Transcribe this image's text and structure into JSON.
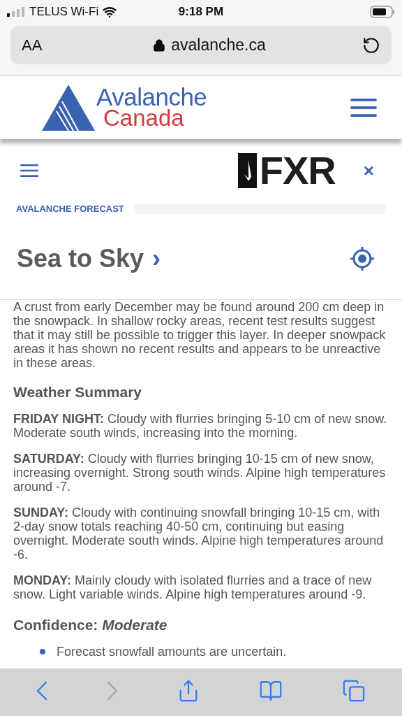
{
  "status_bar": {
    "carrier": "TELUS Wi-Fi",
    "time": "9:18 PM"
  },
  "browser": {
    "text_size_button": "AA",
    "url": "avalanche.ca"
  },
  "site_header": {
    "logo_line_1": "Avalanche",
    "logo_line_2": "Canada"
  },
  "sponsor_bar": {
    "logo": "FXR",
    "close": "×"
  },
  "section_label": "AVALANCHE FORECAST",
  "region_title": "Sea to Sky",
  "region_chevron": "›",
  "intro": "A crust from early December may be found around 200 cm deep in the snowpack. In shallow rocky areas, recent test results suggest that it may still be possible to trigger this layer. In deeper snowpack areas it has shown no recent results and appears to be unreactive in these areas.",
  "weather_heading": "Weather Summary",
  "weather": [
    {
      "text": "**FRIDAY NIGHT:** Cloudy with flurries bringing 5-10 cm of new snow. Moderate south winds, increasing into the morning."
    },
    {
      "text": "**SATURDAY:** Cloudy with flurries bringing 10-15 cm of new snow, increasing overnight. Strong south winds. Alpine high temperatures around -7."
    },
    {
      "text": "**SUNDAY:** Cloudy with continuing snowfall bringing 10-15 cm, with 2-day snow totals reaching 40-50 cm, continuing but easing overnight. Moderate south winds. Alpine high temperatures around -6."
    },
    {
      "text": "**MONDAY:** Mainly cloudy with isolated flurries and a trace of new snow. Light variable winds. Alpine high temperatures around -9."
    }
  ],
  "confidence_heading": "Confidence: *Moderate*",
  "confidence_bullets": [
    "Forecast snowfall amounts are uncertain."
  ],
  "toolbar": [
    {
      "kind": "back",
      "disabled": false
    },
    {
      "kind": "forward",
      "disabled": true
    },
    {
      "kind": "share",
      "disabled": false
    },
    {
      "kind": "bookmarks",
      "disabled": false
    },
    {
      "kind": "tabs",
      "disabled": false
    }
  ]
}
